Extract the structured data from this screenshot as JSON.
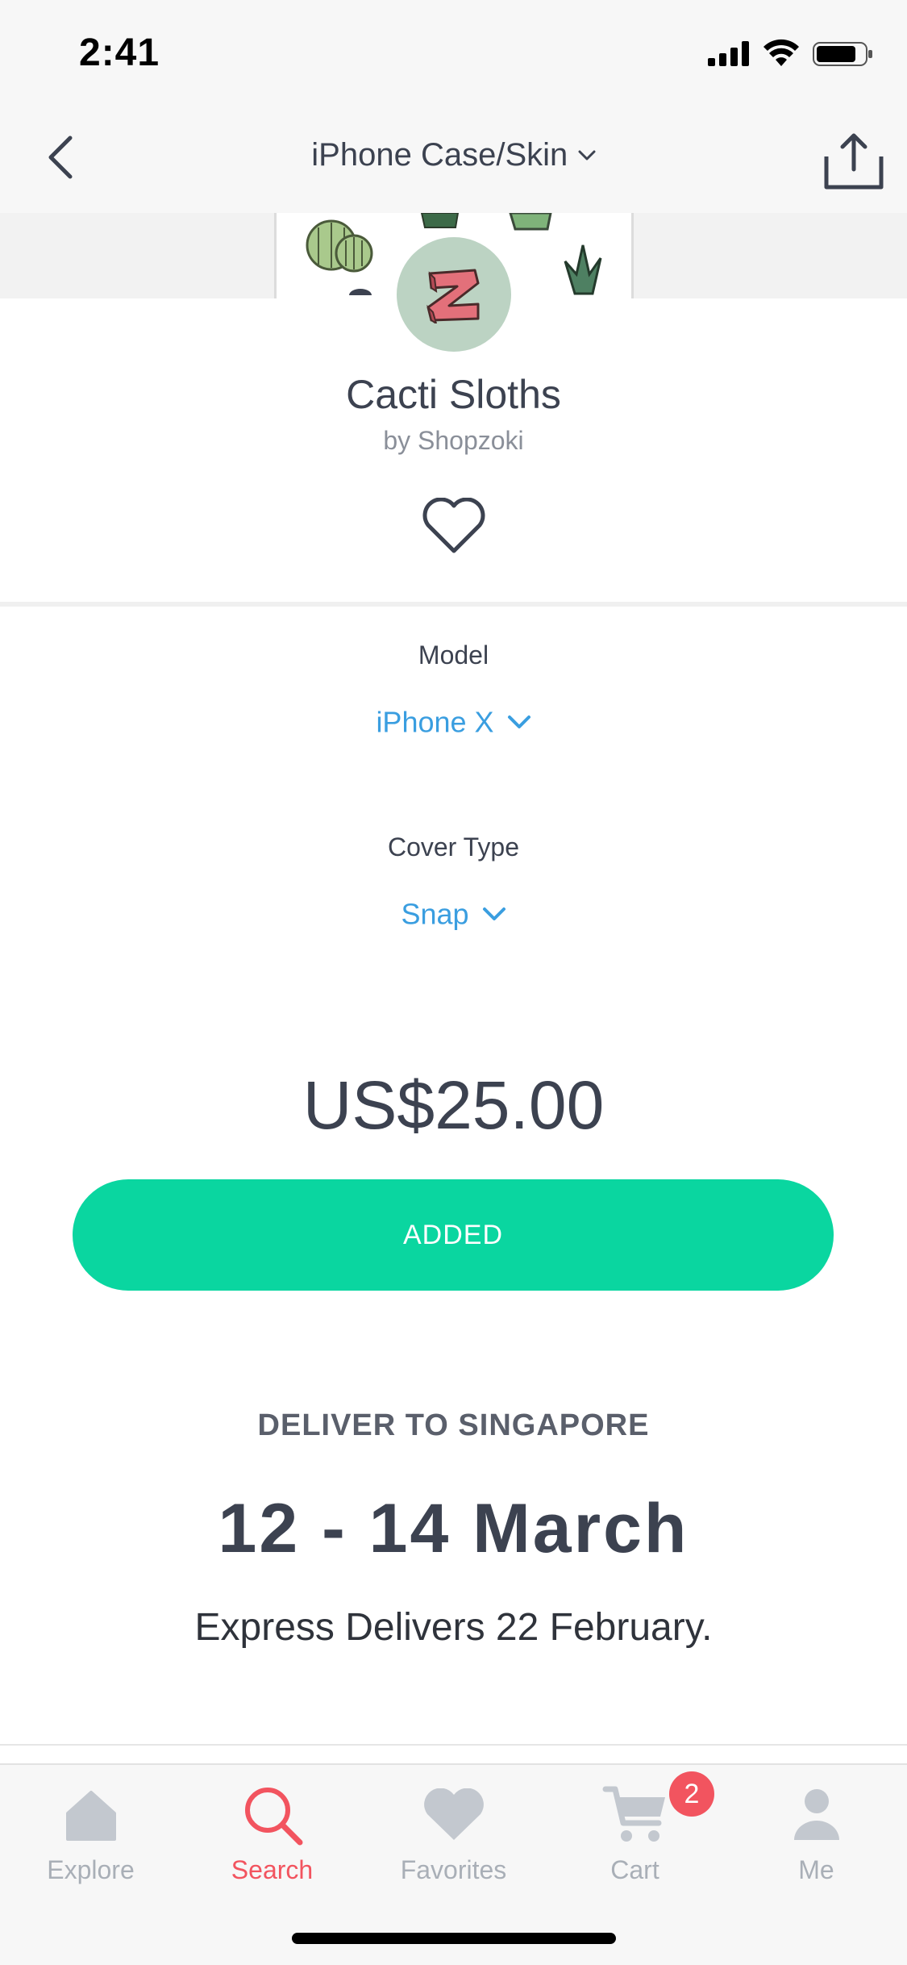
{
  "status_bar": {
    "time": "2:41"
  },
  "nav": {
    "title": "iPhone Case/Skin"
  },
  "product": {
    "title": "Cacti Sloths",
    "author": "by Shopzoki",
    "avatar_letter": "Z",
    "avatar_color": "#bcd3c3"
  },
  "options": {
    "model_label": "Model",
    "model_value": "iPhone X",
    "cover_label": "Cover Type",
    "cover_value": "Snap"
  },
  "price": "US$25.00",
  "add_button": {
    "label": "ADDED",
    "color": "#0ad6a0"
  },
  "delivery": {
    "heading": "DELIVER TO SINGAPORE",
    "dates": "12 - 14 March",
    "express": "Express Delivers 22 February."
  },
  "tabs": [
    {
      "label": "Explore",
      "icon": "home-icon",
      "active": false
    },
    {
      "label": "Search",
      "icon": "search-icon",
      "active": true
    },
    {
      "label": "Favorites",
      "icon": "heart-icon",
      "active": false
    },
    {
      "label": "Cart",
      "icon": "cart-icon",
      "active": false
    },
    {
      "label": "Me",
      "icon": "user-icon",
      "active": false
    }
  ],
  "cart_badge": "2",
  "colors": {
    "accent": "#0ad6a0",
    "link": "#3a9ee0",
    "active_tab": "#f2545f",
    "inactive_tab": "#a9afb7"
  }
}
